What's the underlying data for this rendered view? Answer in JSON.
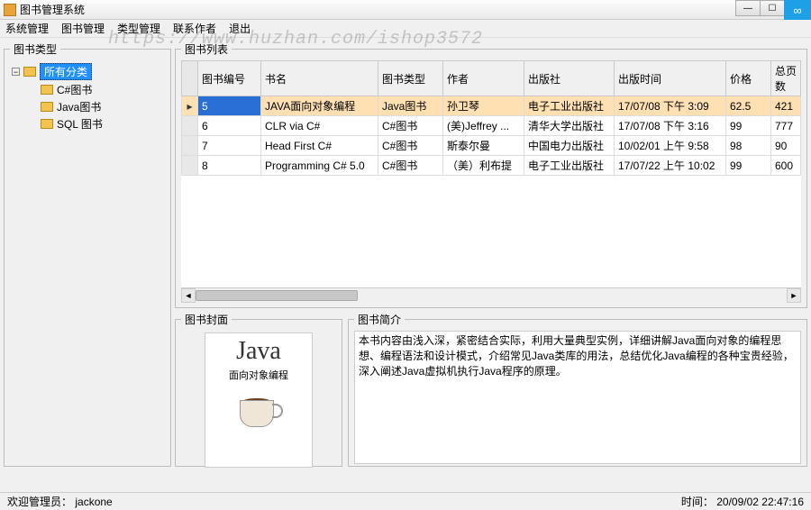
{
  "window": {
    "title": "图书管理系统"
  },
  "menubar": [
    "系统管理",
    "图书管理",
    "类型管理",
    "联系作者",
    "退出"
  ],
  "watermark": "https://www.huzhan.com/ishop3572",
  "sidebar": {
    "legend": "图书类型",
    "root": "所有分类",
    "items": [
      "C#图书",
      "Java图书",
      "SQL 图书"
    ]
  },
  "list": {
    "legend": "图书列表",
    "columns": [
      "图书编号",
      "书名",
      "图书类型",
      "作者",
      "出版社",
      "出版时间",
      "价格",
      "总页数"
    ],
    "rows": [
      {
        "id": "5",
        "name": "JAVA面向对象编程",
        "type": "Java图书",
        "author": "孙卫琴",
        "publisher": "电子工业出版社",
        "date": "17/07/08 下午 3:09",
        "price": "62.5",
        "pages": "421",
        "selected": true
      },
      {
        "id": "6",
        "name": "CLR via C#",
        "type": "C#图书",
        "author": "(美)Jeffrey ...",
        "publisher": "清华大学出版社",
        "date": "17/07/08 下午 3:16",
        "price": "99",
        "pages": "777"
      },
      {
        "id": "7",
        "name": "Head First C#",
        "type": "C#图书",
        "author": "斯泰尔曼",
        "publisher": "中国电力出版社",
        "date": "10/02/01 上午 9:58",
        "price": "98",
        "pages": "90"
      },
      {
        "id": "8",
        "name": "Programming C# 5.0",
        "type": "C#图书",
        "author": "（美）利布提",
        "publisher": "电子工业出版社",
        "date": "17/07/22 上午 10:02",
        "price": "99",
        "pages": "600"
      }
    ]
  },
  "cover": {
    "legend": "图书封面",
    "title": "Java",
    "subtitle": "面向对象编程"
  },
  "description": {
    "legend": "图书简介",
    "text": "本书内容由浅入深，紧密结合实际，利用大量典型实例，详细讲解Java面向对象的编程思想、编程语法和设计模式，介绍常见Java类库的用法，总结优化Java编程的各种宝贵经验，深入阐述Java虚拟机执行Java程序的原理。"
  },
  "statusbar": {
    "left_label": "欢迎管理员：",
    "username": "jackone",
    "time_label": "时间：",
    "time_value": "20/09/02 22:47:16"
  }
}
